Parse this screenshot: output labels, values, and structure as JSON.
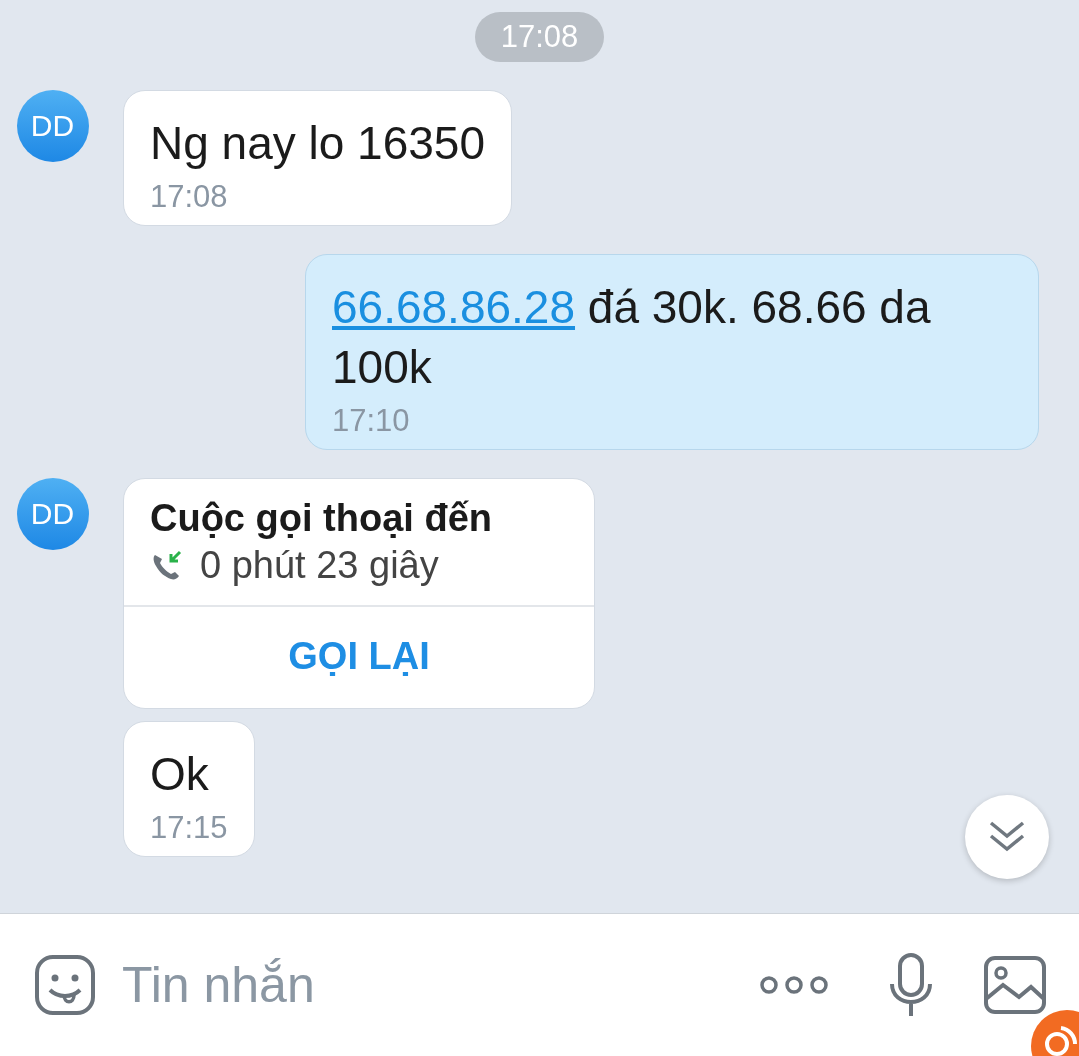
{
  "date_chip": "17:08",
  "messages": [
    {
      "kind": "text",
      "outgoing": false,
      "avatar": "DD",
      "parts": [
        {
          "text": "Ng nay lo 16350",
          "link": false
        }
      ],
      "time": "17:08"
    },
    {
      "kind": "text",
      "outgoing": true,
      "parts": [
        {
          "text": "66.68.86.28",
          "link": true
        },
        {
          "text": " đá 30k. 68.66 da 100k",
          "link": false
        }
      ],
      "time": "17:10"
    },
    {
      "kind": "call",
      "outgoing": false,
      "avatar": "DD",
      "title": "Cuộc gọi thoại đến",
      "duration": "0 phút 23 giây",
      "action": "GỌI LẠI"
    },
    {
      "kind": "text",
      "outgoing": false,
      "parts": [
        {
          "text": "Ok",
          "link": false
        }
      ],
      "time": "17:15"
    }
  ],
  "composer": {
    "placeholder": "Tin nhắn"
  }
}
